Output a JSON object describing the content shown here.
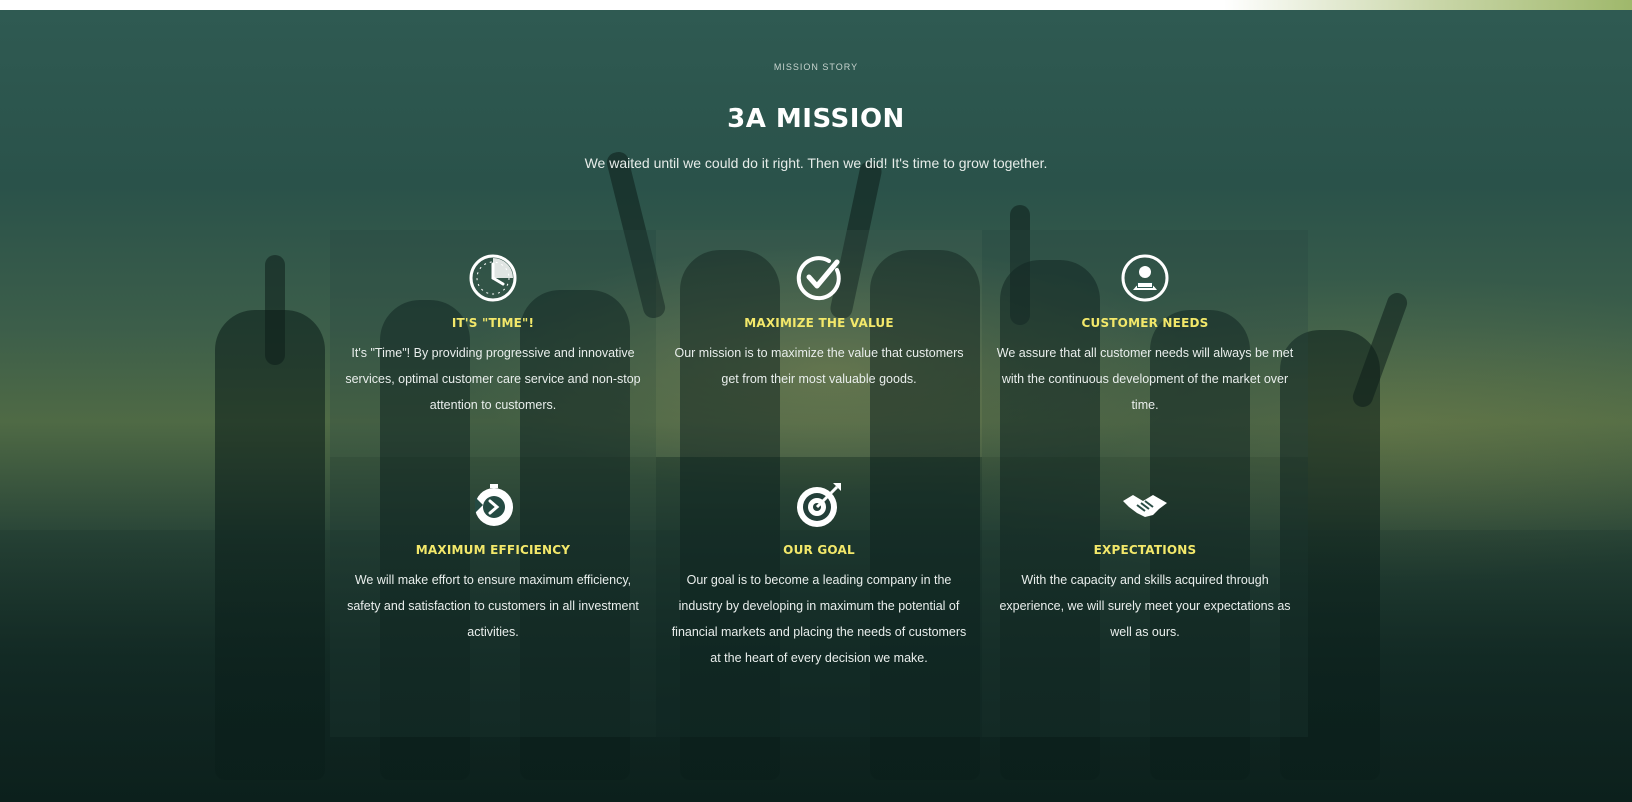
{
  "section": {
    "eyebrow": "MISSION STORY",
    "title": "3A MISSION",
    "subtitle": "We waited until we could do it right. Then we did! It's time to grow together."
  },
  "cards": [
    {
      "icon": "clock-icon",
      "title": "IT'S \"TIME\"!",
      "text": "It's \"Time\"! By providing progressive and innovative services, optimal customer care service and non-stop attention to customers."
    },
    {
      "icon": "check-circle-icon",
      "title": "MAXIMIZE THE VALUE",
      "text": "Our mission is to maximize the value that customers get from their most valuable goods."
    },
    {
      "icon": "customer-support-icon",
      "title": "CUSTOMER NEEDS",
      "text": "We assure that all customer needs will always be met with the continuous development of the market over time."
    },
    {
      "icon": "stopwatch-icon",
      "title": "MAXIMUM EFFICIENCY",
      "text": "We will make effort to ensure maximum efficiency, safety and satisfaction to customers in all investment activities."
    },
    {
      "icon": "target-icon",
      "title": "OUR GOAL",
      "text": "Our goal is to become a leading company in the industry by developing in maximum the potential of financial markets and placing the needs of customers at the heart of every decision we make."
    },
    {
      "icon": "handshake-icon",
      "title": "EXPECTATIONS",
      "text": "With the capacity and skills acquired through experience, we will surely meet your expectations as well as ours."
    }
  ],
  "colors": {
    "accent_title": "#f3e86a",
    "text": "#e9eeec",
    "background": "#2f5a52"
  }
}
